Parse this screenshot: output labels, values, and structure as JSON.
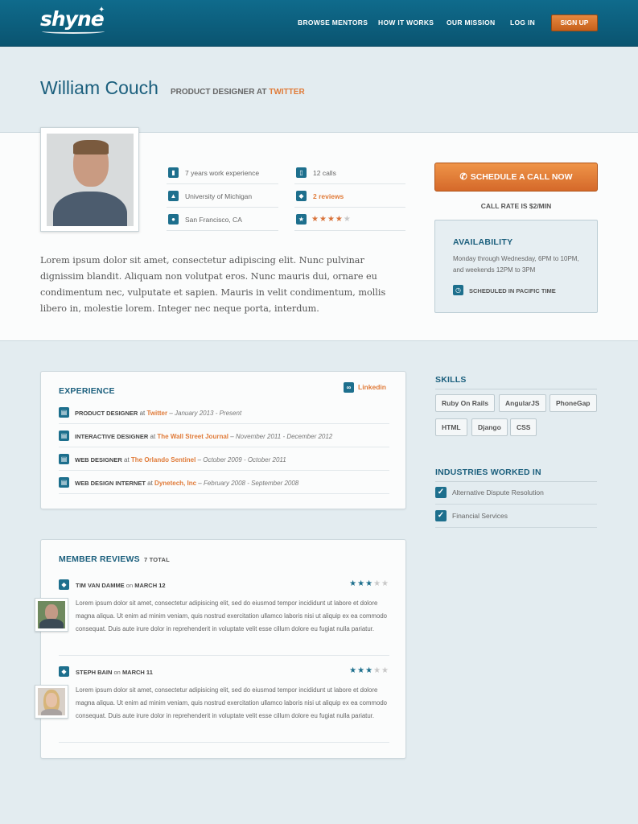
{
  "header": {
    "logo": "shyne",
    "nav": [
      "BROWSE MENTORS",
      "HOW IT WORKS",
      "OUR MISSION",
      "LOG IN"
    ],
    "signup": "SIGN UP"
  },
  "profile": {
    "name": "William Couch",
    "role_prefix": "PRODUCT DESIGNER AT ",
    "company": "TWITTER",
    "facts": {
      "experience": "7 years work experience",
      "school": "University of Michigan",
      "location": "San Francisco, CA",
      "calls": "12 calls",
      "reviews": "2 reviews",
      "rating": 4,
      "rating_max": 5
    },
    "bio": "Lorem ipsum dolor sit amet, consectetur adipiscing elit. Nunc pulvinar dignissim blandit. Aliquam non volutpat eros. Nunc mauris dui, ornare eu condimentum nec, vulputate et sapien. Mauris in velit condimentum, mollis libero in, molestie lorem. Integer nec neque porta, interdum."
  },
  "booking": {
    "button": "SCHEDULE A CALL NOW",
    "rate": "CALL RATE IS $2/MIN",
    "availability_title": "AVAILABILITY",
    "availability_desc": "Monday through Wednesday, 6PM to 10PM, and weekends 12PM to 3PM",
    "timezone": "SCHEDULED IN PACIFIC TIME"
  },
  "experience": {
    "title": "EXPERIENCE",
    "linkedin": "Linkedin",
    "items": [
      {
        "title": "PRODUCT DESIGNER",
        "at": " at ",
        "company": "Twitter",
        "dates": " – January 2013 - Present"
      },
      {
        "title": "INTERACTIVE DESIGNER",
        "at": " at ",
        "company": "The Wall Street Journal",
        "dates": " – November 2011 - December 2012"
      },
      {
        "title": "WEB DESIGNER",
        "at": " at ",
        "company": "The Orlando Sentinel",
        "dates": " – October 2009 - October 2011"
      },
      {
        "title": "WEB DESIGN INTERNET",
        "at": " at ",
        "company": "Dynetech, Inc",
        "dates": " – February 2008 - September 2008"
      }
    ]
  },
  "reviews": {
    "title": "MEMBER REVIEWS",
    "total": "7 TOTAL",
    "items": [
      {
        "author": "TIM VAN DAMME",
        "on": " on ",
        "date": "MARCH 12",
        "rating": 3,
        "text": "Lorem ipsum dolor sit amet, consectetur adipisicing elit, sed do eiusmod tempor incididunt ut labore et dolore magna aliqua. Ut enim ad minim veniam, quis nostrud exercitation ullamco laboris nisi ut aliquip ex ea commodo consequat. Duis aute irure dolor in reprehenderit in voluptate velit esse cillum dolore eu fugiat nulla pariatur."
      },
      {
        "author": "STEPH BAIN",
        "on": " on ",
        "date": "MARCH 11",
        "rating": 3,
        "text": "Lorem ipsum dolor sit amet, consectetur adipisicing elit, sed do eiusmod tempor incididunt ut labore et dolore magna aliqua. Ut enim ad minim veniam, quis nostrud exercitation ullamco laboris nisi ut aliquip ex ea commodo consequat. Duis aute irure dolor in reprehenderit in voluptate velit esse cillum dolore eu fugiat nulla pariatur."
      }
    ]
  },
  "skills": {
    "title": "SKILLS",
    "items": [
      "Ruby On Rails",
      "AngularJS",
      "PhoneGap",
      "HTML",
      "Django",
      "CSS"
    ]
  },
  "industries": {
    "title": "INDUSTRIES WORKED IN",
    "items": [
      "Alternative Dispute Resolution",
      "Financial Services"
    ]
  },
  "colors": {
    "brand": "#0f6b8c",
    "accent": "#e07b39",
    "heading": "#1b5f7d"
  },
  "icons": [
    "bookmark-icon",
    "graduation-cap-icon",
    "map-pin-icon",
    "phone-icon",
    "chat-bubble-icon",
    "star-icon",
    "clock-icon",
    "link-icon",
    "briefcase-icon",
    "checkbox-icon"
  ]
}
